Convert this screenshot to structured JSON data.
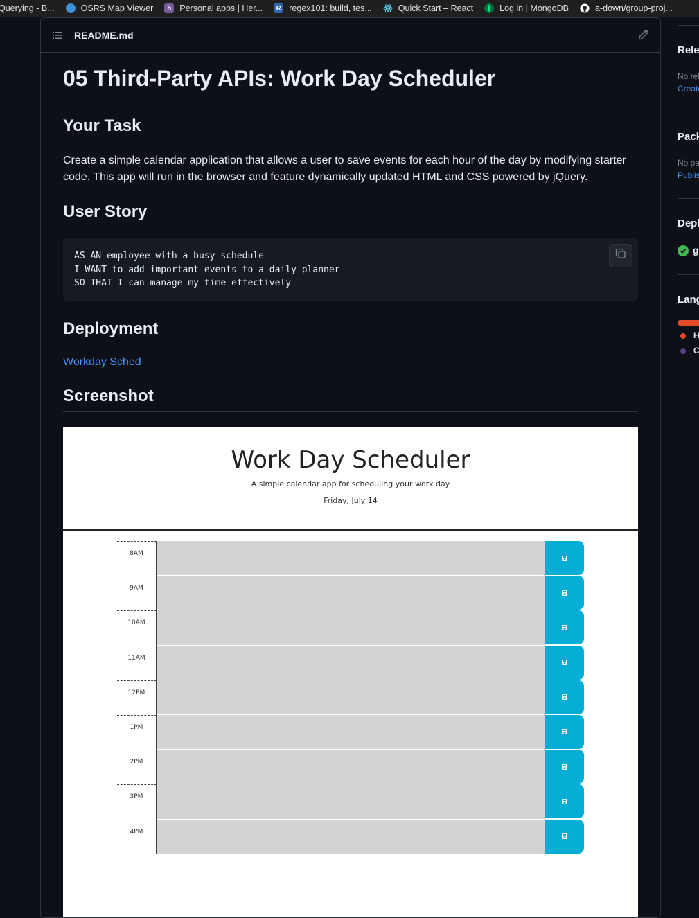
{
  "bookmarks": [
    {
      "label": "Querying - B...",
      "icon": "none",
      "color": "#1f1f1f"
    },
    {
      "label": "OSRS Map Viewer",
      "icon": "globe-icon",
      "color": "#3d8fd6"
    },
    {
      "label": "Personal apps | Her...",
      "icon": "heroku-icon",
      "color": "#79589f"
    },
    {
      "label": "regex101: build, tes...",
      "icon": "regex-icon",
      "color": "#2f66b3"
    },
    {
      "label": "Quick Start – React",
      "icon": "react-icon",
      "color": "#1f1f1f"
    },
    {
      "label": "Log in | MongoDB",
      "icon": "mongodb-icon",
      "color": "#00684a"
    },
    {
      "label": "a-down/group-proj...",
      "icon": "github-icon",
      "color": "#1f1f1f"
    }
  ],
  "readme": {
    "filename": "README.md",
    "h1": "05 Third-Party APIs: Work Day Scheduler",
    "task_heading": "Your Task",
    "task_text": "Create a simple calendar application that allows a user to save events for each hour of the day by modifying starter code. This app will run in the browser and feature dynamically updated HTML and CSS powered by jQuery.",
    "story_heading": "User Story",
    "story_lines": [
      "AS AN employee with a busy schedule",
      "I WANT to add important events to a daily planner",
      "SO THAT I can manage my time effectively"
    ],
    "deployment_heading": "Deployment",
    "deployment_link": "Workday Sched",
    "screenshot_heading": "Screenshot"
  },
  "screenshot": {
    "title": "Work Day Scheduler",
    "subtitle": "A simple calendar app for scheduling your work day",
    "date": "Friday, July 14",
    "hours": [
      "8AM",
      "9AM",
      "10AM",
      "11AM",
      "12PM",
      "1PM",
      "2PM",
      "3PM",
      "4PM"
    ]
  },
  "sidebar": {
    "releases_heading": "Rele",
    "releases_text": "No rel",
    "releases_link": "Create",
    "packages_heading": "Pack",
    "packages_text": "No pa",
    "packages_link": "Publis",
    "deployments_heading": "Depl",
    "deployments_item": "g",
    "languages_heading": "Lang",
    "languages": [
      {
        "label": "H",
        "color": "#e34c26"
      },
      {
        "label": "C",
        "color": "#563d7c"
      }
    ]
  }
}
